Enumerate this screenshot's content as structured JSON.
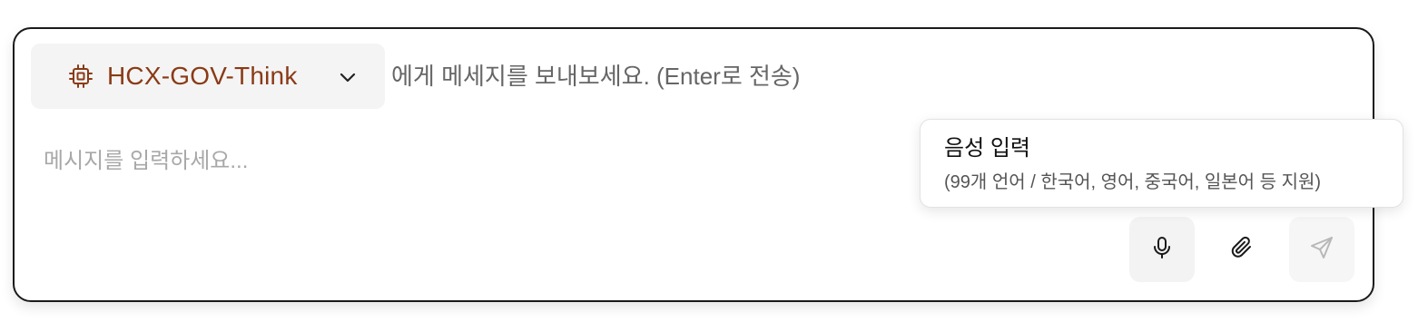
{
  "model_selector": {
    "model_name": "HCX-GOV-Think",
    "icon": "chip-icon",
    "dropdown_icon": "chevron-down-icon",
    "accent_color": "#8a3a16"
  },
  "hint": {
    "text": "에게 메세지를 보내보세요. (Enter로 전송)"
  },
  "message_input": {
    "placeholder": "메시지를 입력하세요...",
    "value": ""
  },
  "actions": {
    "mic_icon": "microphone-icon",
    "attach_icon": "paperclip-icon",
    "send_icon": "send-icon"
  },
  "tooltip": {
    "title": "음성 입력",
    "subtitle": "(99개 언어 / 한국어, 영어, 중국어, 일본어 등 지원)"
  }
}
